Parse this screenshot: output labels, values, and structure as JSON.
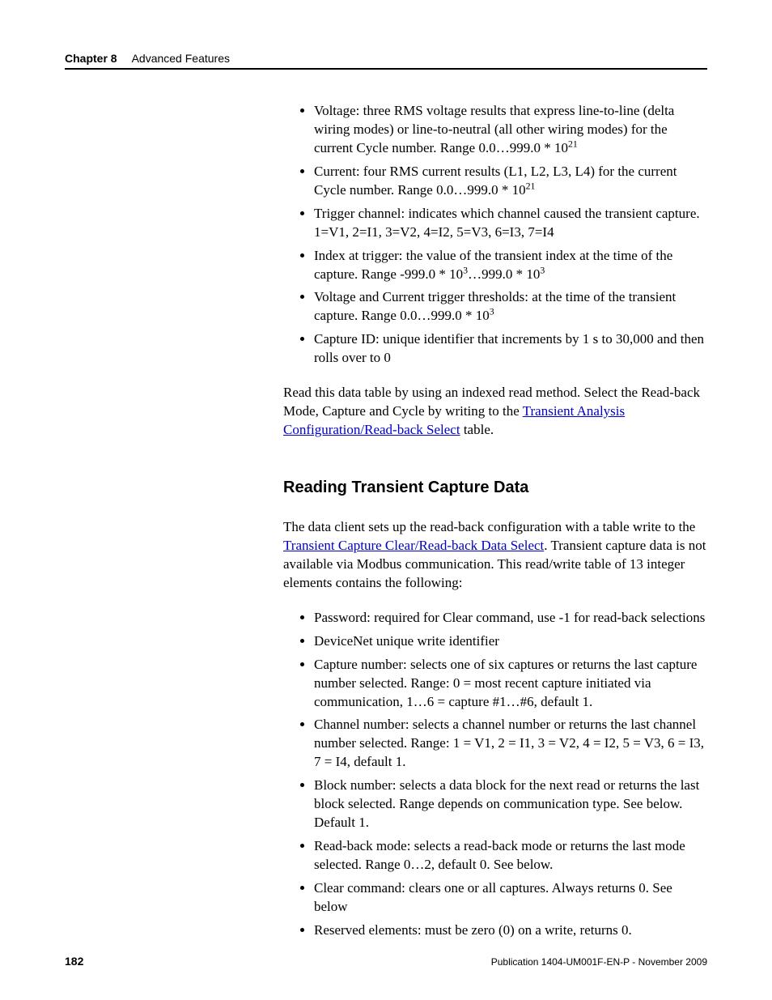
{
  "header": {
    "chapter": "Chapter 8",
    "title": "Advanced Features"
  },
  "bullets1": {
    "voltage_a": "Voltage: three RMS voltage results that express line-to-line (delta wiring modes) or line-to-neutral (all other wiring modes) for the current Cycle number. Range 0.0…999.0 * 10",
    "voltage_exp": "21",
    "current_a": "Current: four RMS current results (L1, L2, L3, L4) for the current Cycle number. Range 0.0…999.0 * 10",
    "current_exp": "21",
    "trigger_channel": "Trigger channel: indicates which channel caused the transient capture. 1=V1, 2=I1, 3=V2, 4=I2, 5=V3, 6=I3, 7=I4",
    "index_a": "Index at trigger: the value of the transient index at the time of the capture. Range -999.0 * 10",
    "index_exp1": "3",
    "index_mid": "…999.0 * 10",
    "index_exp2": "3",
    "thresh_a": "Voltage and Current trigger thresholds: at the time of the transient capture. Range 0.0…999.0 * 10",
    "thresh_exp": "3",
    "capture_id": "Capture ID: unique identifier that increments by 1 s to 30,000 and then rolls over to 0"
  },
  "para1_a": "Read this data table by using an indexed read method. Select the Read-back Mode, Capture and Cycle by writing to the ",
  "para1_link": "Transient Analysis Configuration/Read-back Select",
  "para1_b": " table.",
  "heading2": "Reading Transient Capture Data",
  "para2_a": "The data client sets up the read-back configuration with a table write to the ",
  "para2_link": "Transient Capture Clear/Read-back Data Select",
  "para2_b": ". Transient capture data is not available via Modbus communication. This read/write table of 13 integer elements contains the following:",
  "bullets2": {
    "password": "Password: required for Clear command, use -1 for read-back selections",
    "devicenet": "DeviceNet unique write identifier",
    "capture_number": "Capture number: selects one of six captures or returns the last capture number selected. Range: 0 = most recent capture initiated via communication, 1…6 = capture #1…#6, default 1.",
    "channel_number": "Channel number: selects a channel number or returns the last channel number selected. Range: 1 = V1, 2 = I1, 3 = V2, 4 = I2, 5 = V3, 6 = I3, 7 = I4, default 1.",
    "block_number": "Block number: selects a data block for the next read or returns the last block selected. Range depends on communication type. See below. Default 1.",
    "readback_mode": "Read-back mode: selects a read-back mode or returns the last mode selected. Range 0…2, default 0. See below.",
    "clear_command": "Clear command: clears one or all captures. Always returns 0. See below",
    "reserved": "Reserved elements: must be zero (0) on a write, returns 0."
  },
  "footer": {
    "page": "182",
    "publication": "Publication 1404-UM001F-EN-P - November 2009"
  }
}
